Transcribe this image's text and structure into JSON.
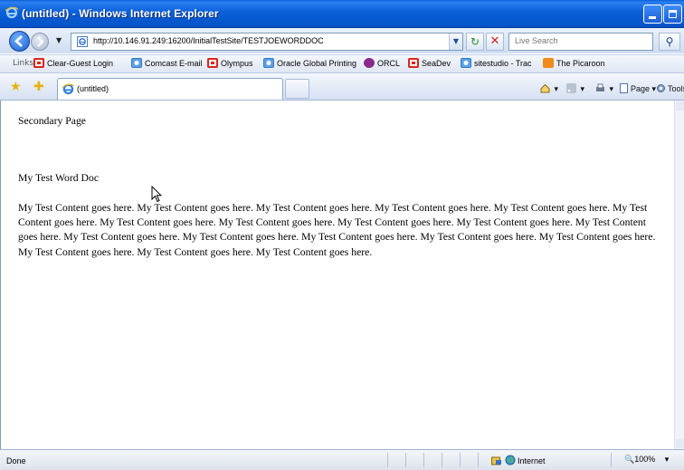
{
  "window": {
    "title": "(untitled) - Windows Internet Explorer"
  },
  "address_bar": {
    "url": "http://10.146.91.249:16200/InitialTestSite/TESTJOEWORDDOC",
    "search_placeholder": "Live Search"
  },
  "links_bar": {
    "label": "Links",
    "items": [
      {
        "label": "Clear-Guest Login",
        "icon": "red-square-icon"
      },
      {
        "label": "Comcast E-mail",
        "icon": "ie-page-icon"
      },
      {
        "label": "Olympus",
        "icon": "red-square-icon"
      },
      {
        "label": "Oracle Global Printing",
        "icon": "ie-page-icon"
      },
      {
        "label": "ORCL",
        "icon": "yahoo-icon"
      },
      {
        "label": "SeaDev",
        "icon": "red-square-icon"
      },
      {
        "label": "sitestudio - Trac",
        "icon": "ie-page-icon"
      },
      {
        "label": "The Picaroon",
        "icon": "blogger-icon"
      }
    ]
  },
  "tab": {
    "title": "(untitled)"
  },
  "command_bar": {
    "page_label": "Page",
    "tools_label": "Tools"
  },
  "content": {
    "secondary": "Secondary Page",
    "title": "My Test Word Doc",
    "body": "My Test Content goes here. My Test Content goes here. My Test Content goes here. My Test Content goes here. My Test Content goes here. My Test Content goes here. My Test Content goes here. My Test Content goes here. My Test Content goes here. My Test Content goes here. My Test Content goes here. My Test Content goes here. My Test Content goes here. My Test Content goes here. My Test Content goes here. My Test Content goes here. My Test Content goes here. My Test Content goes here. My Test Content goes here."
  },
  "status_bar": {
    "status": "Done",
    "zone": "Internet",
    "zoom": "100%"
  },
  "colors": {
    "titlebar": "#0a5fd8",
    "chrome": "#dfe7f4"
  }
}
